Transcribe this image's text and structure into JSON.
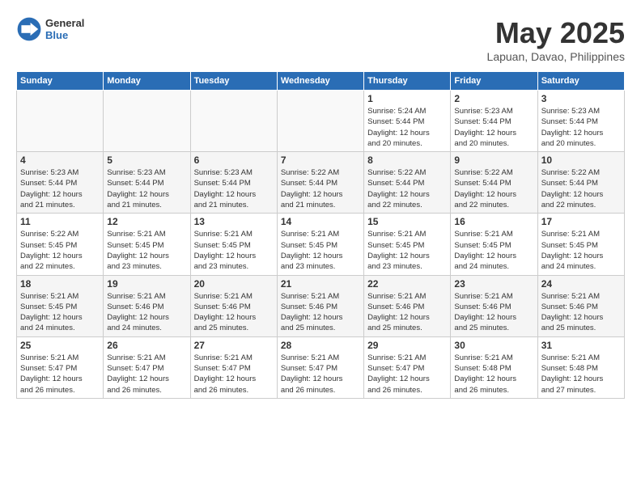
{
  "logo": {
    "general": "General",
    "blue": "Blue"
  },
  "title": "May 2025",
  "location": "Lapuan, Davao, Philippines",
  "weekdays": [
    "Sunday",
    "Monday",
    "Tuesday",
    "Wednesday",
    "Thursday",
    "Friday",
    "Saturday"
  ],
  "weeks": [
    [
      {
        "day": "",
        "info": ""
      },
      {
        "day": "",
        "info": ""
      },
      {
        "day": "",
        "info": ""
      },
      {
        "day": "",
        "info": ""
      },
      {
        "day": "1",
        "info": "Sunrise: 5:24 AM\nSunset: 5:44 PM\nDaylight: 12 hours\nand 20 minutes."
      },
      {
        "day": "2",
        "info": "Sunrise: 5:23 AM\nSunset: 5:44 PM\nDaylight: 12 hours\nand 20 minutes."
      },
      {
        "day": "3",
        "info": "Sunrise: 5:23 AM\nSunset: 5:44 PM\nDaylight: 12 hours\nand 20 minutes."
      }
    ],
    [
      {
        "day": "4",
        "info": "Sunrise: 5:23 AM\nSunset: 5:44 PM\nDaylight: 12 hours\nand 21 minutes."
      },
      {
        "day": "5",
        "info": "Sunrise: 5:23 AM\nSunset: 5:44 PM\nDaylight: 12 hours\nand 21 minutes."
      },
      {
        "day": "6",
        "info": "Sunrise: 5:23 AM\nSunset: 5:44 PM\nDaylight: 12 hours\nand 21 minutes."
      },
      {
        "day": "7",
        "info": "Sunrise: 5:22 AM\nSunset: 5:44 PM\nDaylight: 12 hours\nand 21 minutes."
      },
      {
        "day": "8",
        "info": "Sunrise: 5:22 AM\nSunset: 5:44 PM\nDaylight: 12 hours\nand 22 minutes."
      },
      {
        "day": "9",
        "info": "Sunrise: 5:22 AM\nSunset: 5:44 PM\nDaylight: 12 hours\nand 22 minutes."
      },
      {
        "day": "10",
        "info": "Sunrise: 5:22 AM\nSunset: 5:44 PM\nDaylight: 12 hours\nand 22 minutes."
      }
    ],
    [
      {
        "day": "11",
        "info": "Sunrise: 5:22 AM\nSunset: 5:45 PM\nDaylight: 12 hours\nand 22 minutes."
      },
      {
        "day": "12",
        "info": "Sunrise: 5:21 AM\nSunset: 5:45 PM\nDaylight: 12 hours\nand 23 minutes."
      },
      {
        "day": "13",
        "info": "Sunrise: 5:21 AM\nSunset: 5:45 PM\nDaylight: 12 hours\nand 23 minutes."
      },
      {
        "day": "14",
        "info": "Sunrise: 5:21 AM\nSunset: 5:45 PM\nDaylight: 12 hours\nand 23 minutes."
      },
      {
        "day": "15",
        "info": "Sunrise: 5:21 AM\nSunset: 5:45 PM\nDaylight: 12 hours\nand 23 minutes."
      },
      {
        "day": "16",
        "info": "Sunrise: 5:21 AM\nSunset: 5:45 PM\nDaylight: 12 hours\nand 24 minutes."
      },
      {
        "day": "17",
        "info": "Sunrise: 5:21 AM\nSunset: 5:45 PM\nDaylight: 12 hours\nand 24 minutes."
      }
    ],
    [
      {
        "day": "18",
        "info": "Sunrise: 5:21 AM\nSunset: 5:45 PM\nDaylight: 12 hours\nand 24 minutes."
      },
      {
        "day": "19",
        "info": "Sunrise: 5:21 AM\nSunset: 5:46 PM\nDaylight: 12 hours\nand 24 minutes."
      },
      {
        "day": "20",
        "info": "Sunrise: 5:21 AM\nSunset: 5:46 PM\nDaylight: 12 hours\nand 25 minutes."
      },
      {
        "day": "21",
        "info": "Sunrise: 5:21 AM\nSunset: 5:46 PM\nDaylight: 12 hours\nand 25 minutes."
      },
      {
        "day": "22",
        "info": "Sunrise: 5:21 AM\nSunset: 5:46 PM\nDaylight: 12 hours\nand 25 minutes."
      },
      {
        "day": "23",
        "info": "Sunrise: 5:21 AM\nSunset: 5:46 PM\nDaylight: 12 hours\nand 25 minutes."
      },
      {
        "day": "24",
        "info": "Sunrise: 5:21 AM\nSunset: 5:46 PM\nDaylight: 12 hours\nand 25 minutes."
      }
    ],
    [
      {
        "day": "25",
        "info": "Sunrise: 5:21 AM\nSunset: 5:47 PM\nDaylight: 12 hours\nand 26 minutes."
      },
      {
        "day": "26",
        "info": "Sunrise: 5:21 AM\nSunset: 5:47 PM\nDaylight: 12 hours\nand 26 minutes."
      },
      {
        "day": "27",
        "info": "Sunrise: 5:21 AM\nSunset: 5:47 PM\nDaylight: 12 hours\nand 26 minutes."
      },
      {
        "day": "28",
        "info": "Sunrise: 5:21 AM\nSunset: 5:47 PM\nDaylight: 12 hours\nand 26 minutes."
      },
      {
        "day": "29",
        "info": "Sunrise: 5:21 AM\nSunset: 5:47 PM\nDaylight: 12 hours\nand 26 minutes."
      },
      {
        "day": "30",
        "info": "Sunrise: 5:21 AM\nSunset: 5:48 PM\nDaylight: 12 hours\nand 26 minutes."
      },
      {
        "day": "31",
        "info": "Sunrise: 5:21 AM\nSunset: 5:48 PM\nDaylight: 12 hours\nand 27 minutes."
      }
    ]
  ]
}
